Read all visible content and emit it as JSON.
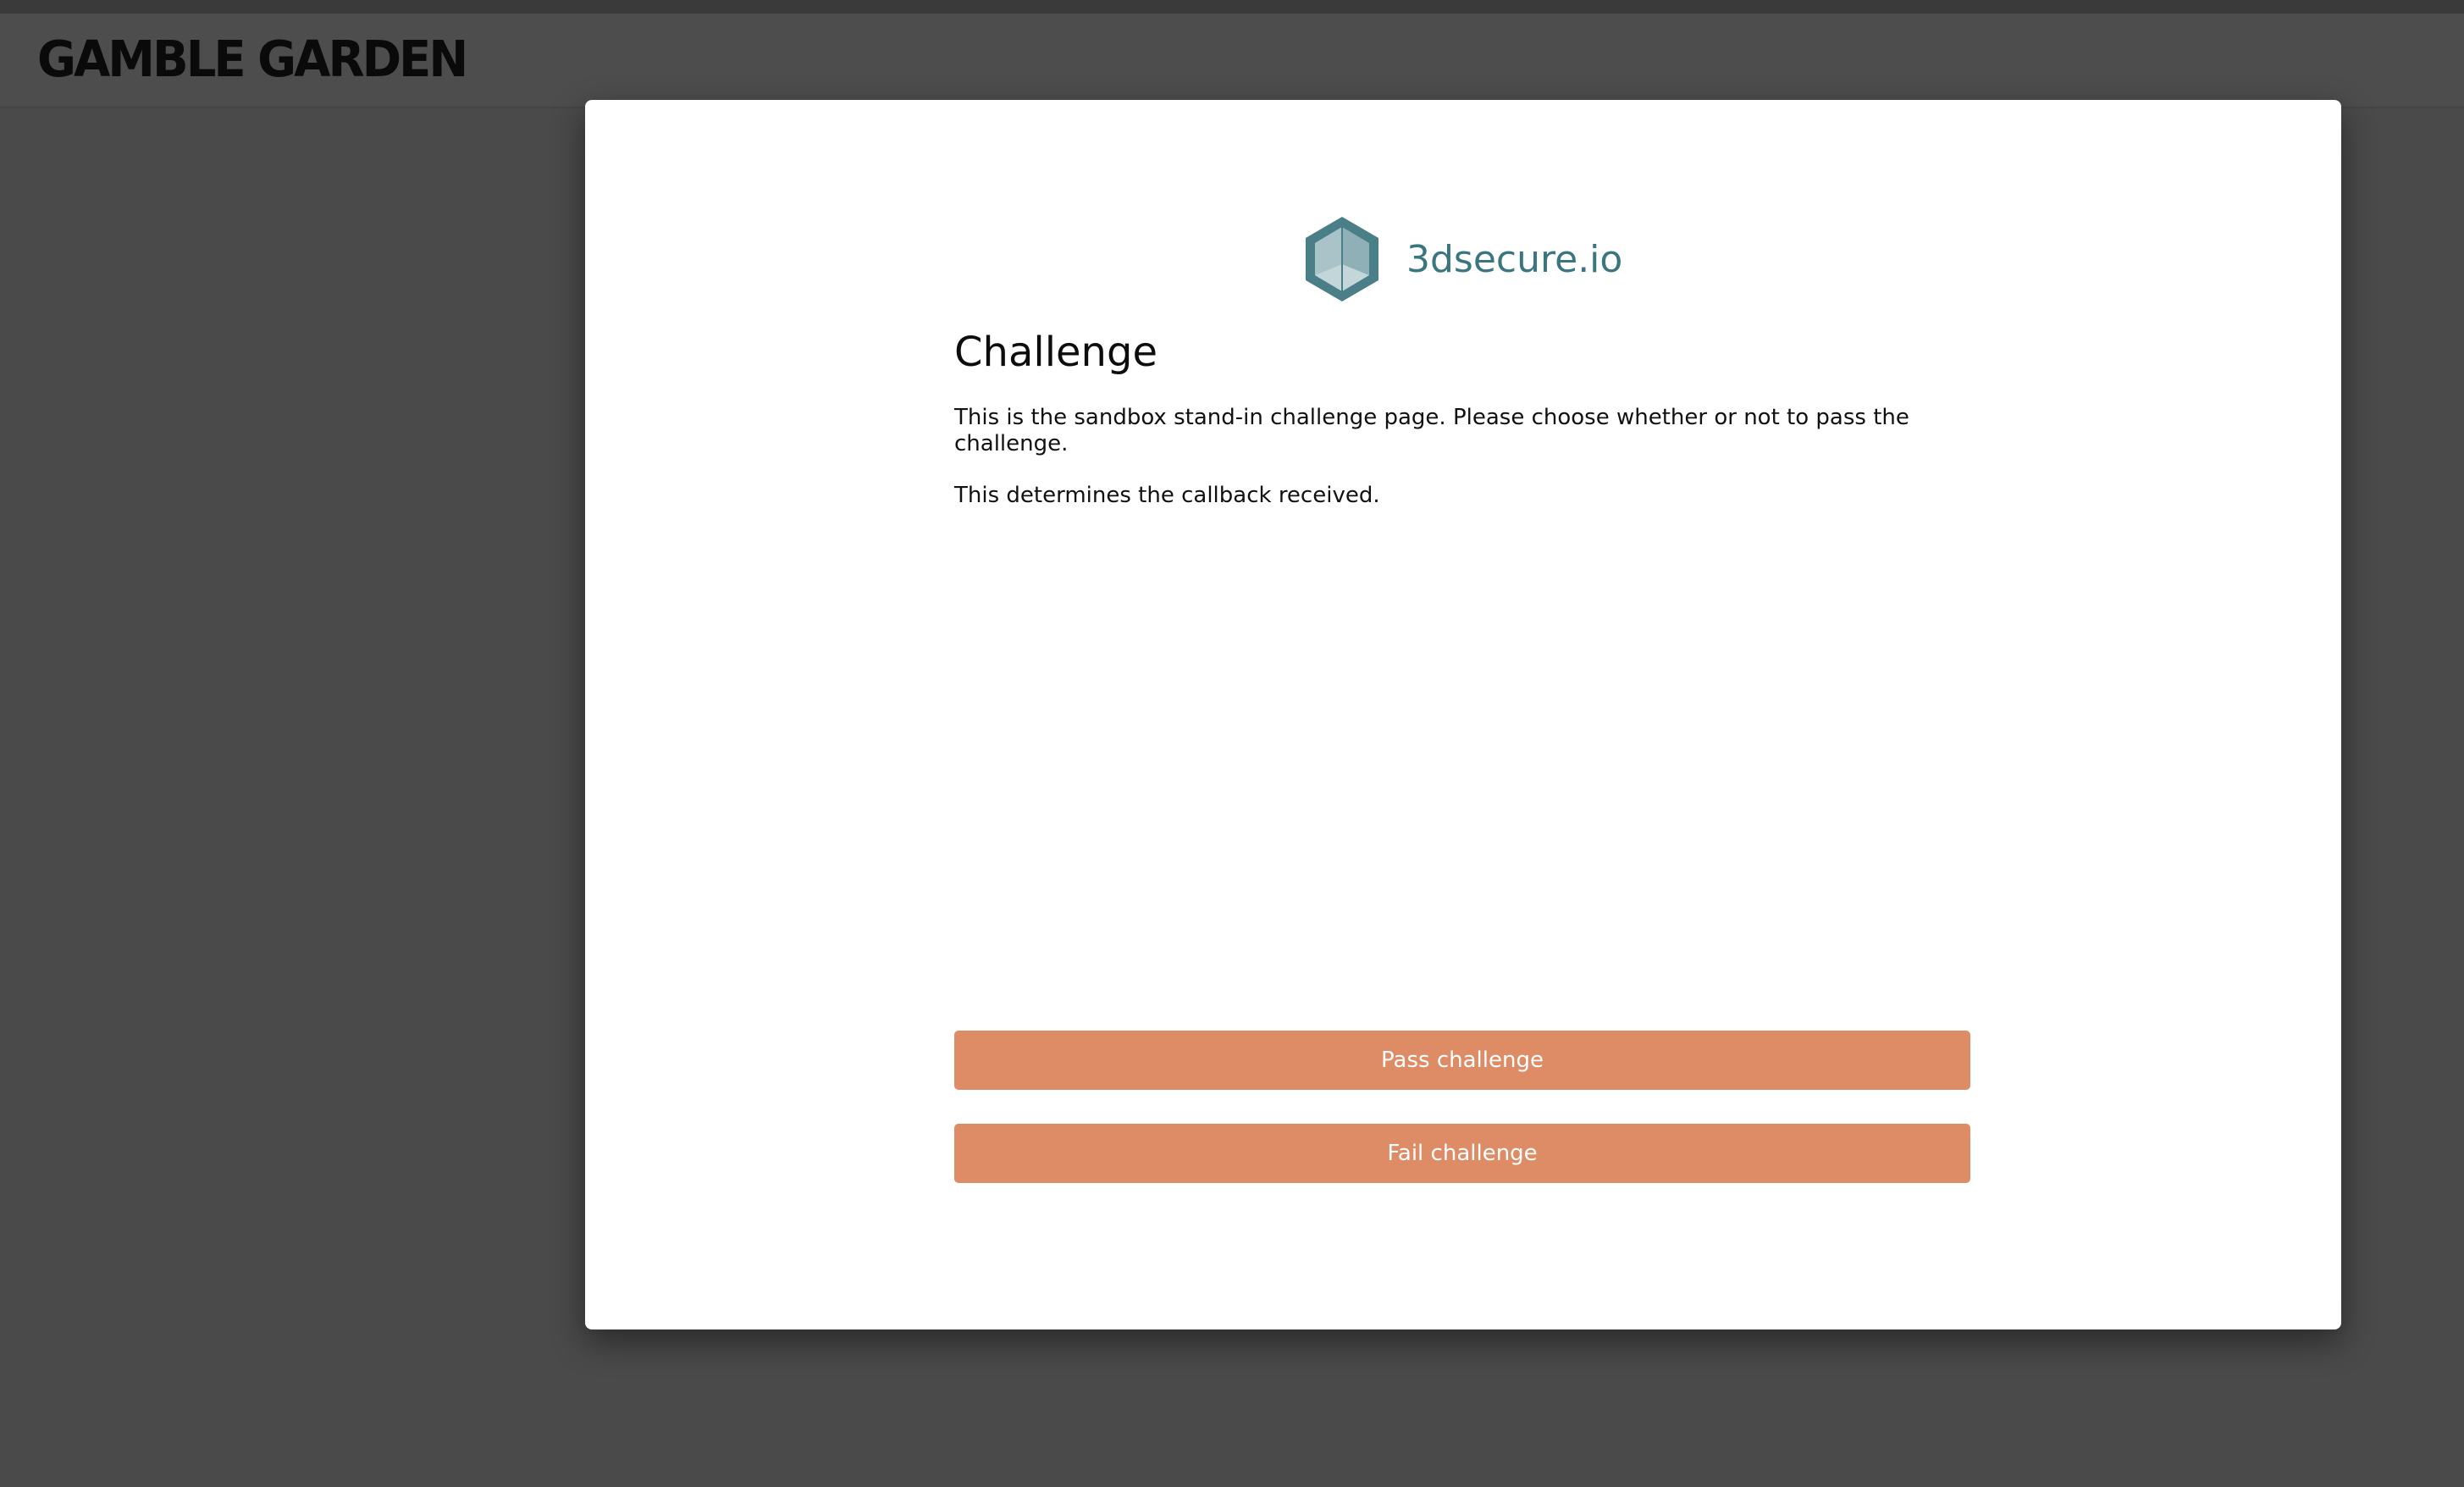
{
  "site": {
    "logo_text": "GAMBLE GARDEN"
  },
  "modal": {
    "brand_name": "3dsecure.io",
    "brand_icon": "hexagon-cube-icon",
    "title": "Challenge",
    "paragraphs": [
      "This is the sandbox stand-in challenge page. Please choose whether or not to pass the challenge.",
      "This determines the callback received."
    ],
    "buttons": {
      "pass_label": "Pass challenge",
      "fail_label": "Fail challenge"
    }
  },
  "colors": {
    "backdrop": "#4a4a4a",
    "button": "#dd8c65",
    "brand_teal": "#3b7680",
    "icon_dark": "#4a7f88",
    "icon_light": "#8fb0b6"
  }
}
